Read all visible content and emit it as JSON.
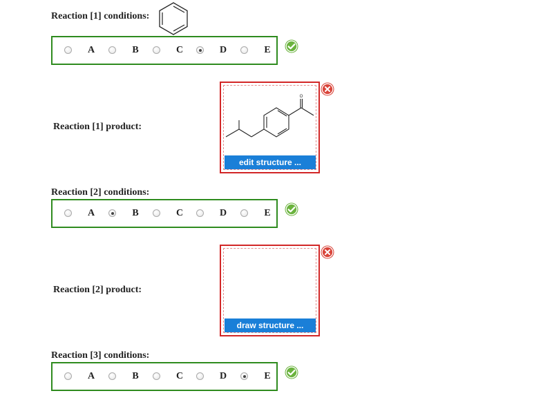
{
  "reaction1": {
    "conditions_label": "Reaction [1] conditions:",
    "options": [
      "A",
      "B",
      "C",
      "D",
      "E"
    ],
    "selected": "D",
    "product_label": "Reaction [1] product:",
    "product_button": "edit structure ..."
  },
  "reaction2": {
    "conditions_label": "Reaction [2] conditions:",
    "options": [
      "A",
      "B",
      "C",
      "D",
      "E"
    ],
    "selected": "B",
    "product_label": "Reaction [2] product:",
    "product_button": "draw structure ..."
  },
  "reaction3": {
    "conditions_label": "Reaction [3] conditions:",
    "options": [
      "A",
      "B",
      "C",
      "D",
      "E"
    ],
    "selected": "E"
  },
  "icons": {
    "correct": "check-circle-icon",
    "incorrect": "x-circle-icon"
  },
  "colors": {
    "correct_border": "#2e8b1e",
    "incorrect_border": "#d22626",
    "button_blue": "#1a7fd8"
  }
}
